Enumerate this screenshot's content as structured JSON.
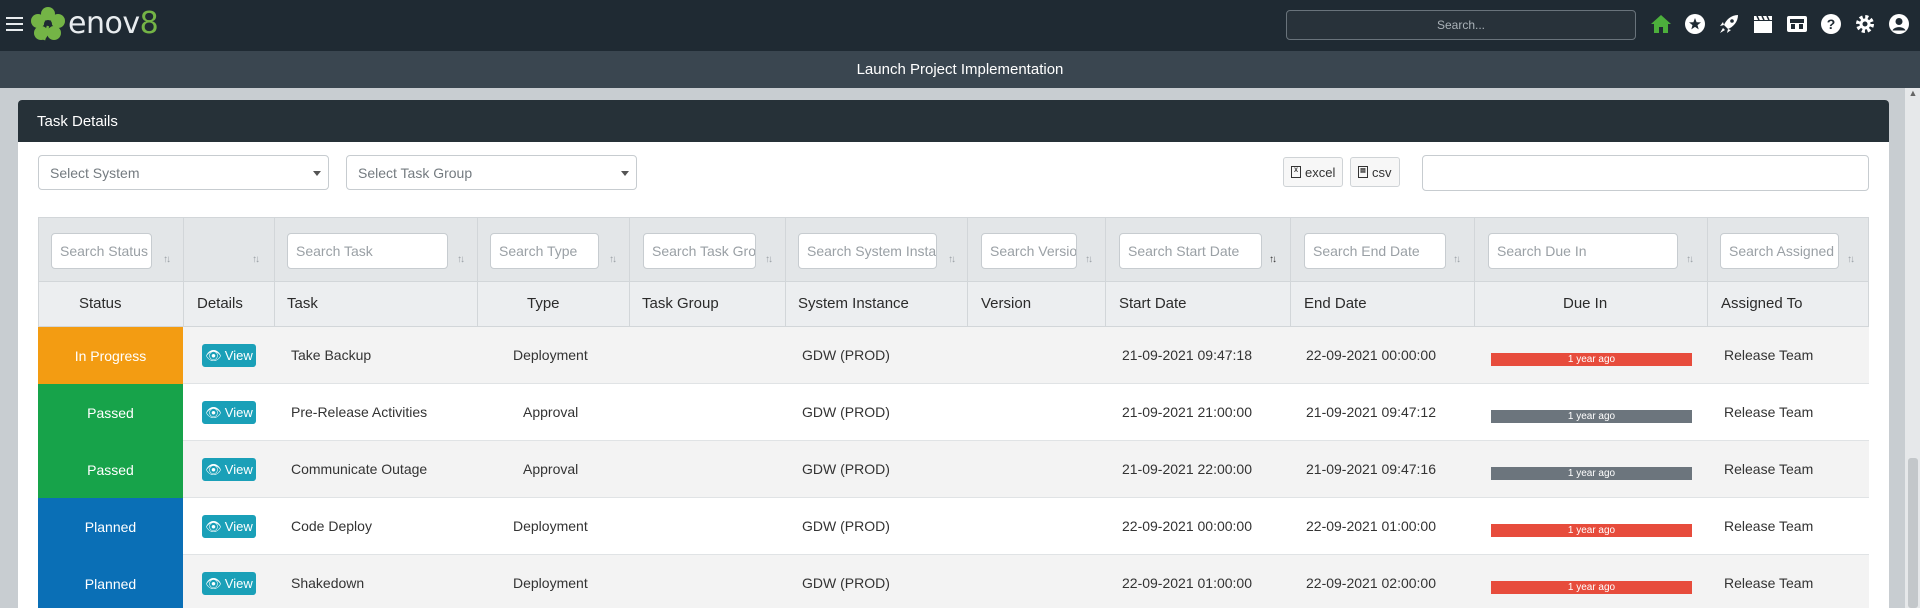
{
  "brand": {
    "logo_text_main": "enov",
    "logo_text_accent": "8",
    "leaf_color": "#74b446"
  },
  "navbar": {
    "search_placeholder": "Search...",
    "icons": [
      "home-icon",
      "star-icon",
      "rocket-icon",
      "clapperboard-icon",
      "id-card-icon",
      "help-icon",
      "gear-icon",
      "user-icon"
    ]
  },
  "subheader": {
    "title": "Launch Project Implementation"
  },
  "panel": {
    "title": "Task Details",
    "select_system": "Select System",
    "select_task_group": "Select Task Group",
    "export_excel": "excel",
    "export_csv": "csv"
  },
  "table": {
    "search_placeholders": {
      "status": "Search Status",
      "task": "Search Task",
      "type": "Search Type",
      "task_group": "Search Task Group",
      "system_instance": "Search System Instance",
      "version": "Search Version",
      "start_date": "Search Start Date",
      "end_date": "Search End Date",
      "due_in": "Search Due In",
      "assigned_to": "Search Assigned To"
    },
    "headers": {
      "status": "Status",
      "details": "Details",
      "task": "Task",
      "type": "Type",
      "task_group": "Task Group",
      "system_instance": "System Instance",
      "version": "Version",
      "start_date": "Start Date",
      "end_date": "End Date",
      "due_in": "Due In",
      "assigned_to": "Assigned To"
    },
    "view_label": "View",
    "rows": [
      {
        "status": "In Progress",
        "status_color": "#f39c12",
        "task": "Take Backup",
        "type": "Deployment",
        "task_group": "",
        "system_instance": "GDW (PROD)",
        "version": "",
        "start_date": "21-09-2021 09:47:18",
        "end_date": "22-09-2021 00:00:00",
        "due_in": "1 year ago",
        "due_color": "#e74c3c",
        "assigned_to": "Release Team"
      },
      {
        "status": "Passed",
        "status_color": "#17a34a",
        "task": "Pre-Release Activities",
        "type": "Approval",
        "task_group": "",
        "system_instance": "GDW (PROD)",
        "version": "",
        "start_date": "21-09-2021 21:00:00",
        "end_date": "21-09-2021 09:47:12",
        "due_in": "1 year ago",
        "due_color": "#6c757d",
        "assigned_to": "Release Team"
      },
      {
        "status": "Passed",
        "status_color": "#17a34a",
        "task": "Communicate Outage",
        "type": "Approval",
        "task_group": "",
        "system_instance": "GDW (PROD)",
        "version": "",
        "start_date": "21-09-2021 22:00:00",
        "end_date": "21-09-2021 09:47:16",
        "due_in": "1 year ago",
        "due_color": "#6c757d",
        "assigned_to": "Release Team"
      },
      {
        "status": "Planned",
        "status_color": "#0a6fb6",
        "task": "Code Deploy",
        "type": "Deployment",
        "task_group": "",
        "system_instance": "GDW (PROD)",
        "version": "",
        "start_date": "22-09-2021 00:00:00",
        "end_date": "22-09-2021 01:00:00",
        "due_in": "1 year ago",
        "due_color": "#e74c3c",
        "assigned_to": "Release Team"
      },
      {
        "status": "Planned",
        "status_color": "#0a6fb6",
        "task": "Shakedown",
        "type": "Deployment",
        "task_group": "",
        "system_instance": "GDW (PROD)",
        "version": "",
        "start_date": "22-09-2021 01:00:00",
        "end_date": "22-09-2021 02:00:00",
        "due_in": "1 year ago",
        "due_color": "#e74c3c",
        "assigned_to": "Release Team"
      }
    ]
  }
}
